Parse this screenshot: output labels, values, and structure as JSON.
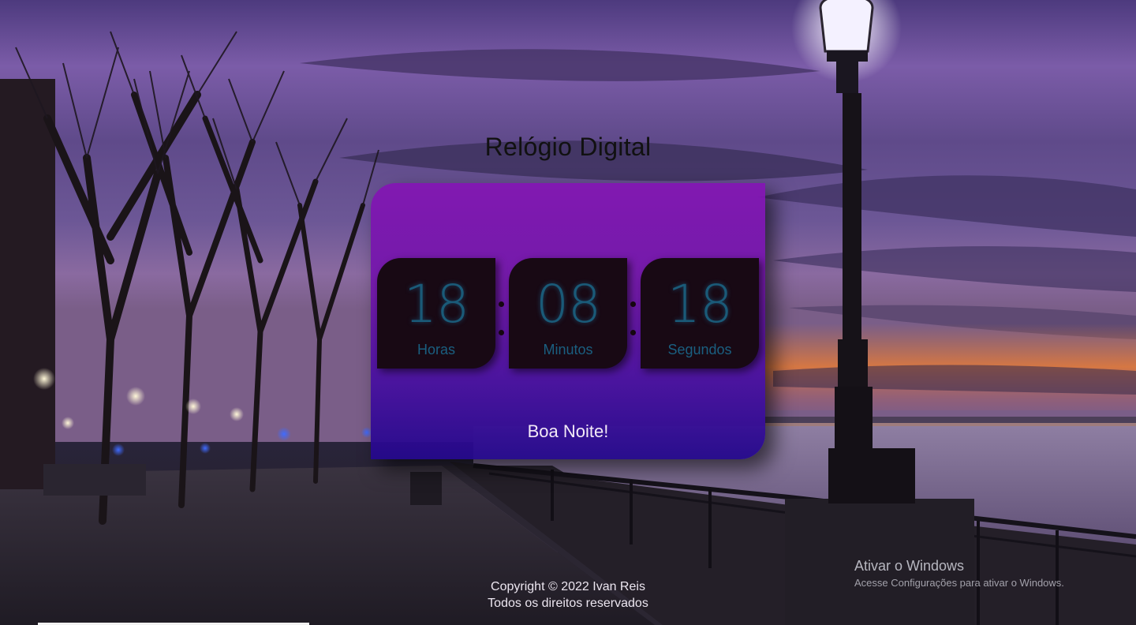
{
  "page": {
    "title": "Relógio Digital"
  },
  "clock": {
    "hours": "18",
    "minutes": "08",
    "seconds": "18",
    "hours_label": "Horas",
    "minutes_label": "Minutos",
    "seconds_label": "Segundos",
    "greeting": "Boa Noite!"
  },
  "footer": {
    "copyright": "Copyright © 2022 Ivan Reis",
    "rights": "Todos os direitos reservados"
  },
  "windows_watermark": {
    "title": "Ativar o Windows",
    "subtitle": "Acesse Configurações para ativar o Windows."
  },
  "colors": {
    "card_top": "#8414b4",
    "card_bottom": "#24088c",
    "digit_box": "#180914",
    "digit_text": "#1a5a78"
  }
}
